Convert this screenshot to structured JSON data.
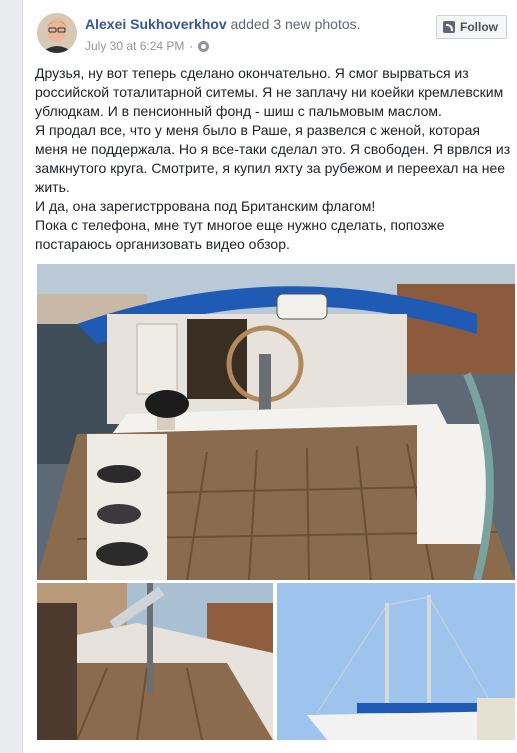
{
  "post": {
    "author": "Alexei Sukhoverkhov",
    "action": "added 3 new photos.",
    "timestamp": "July 30 at 6:24 PM",
    "dot": "·",
    "privacy_icon": "globe-icon",
    "follow_label": "Follow",
    "text_lines": [
      "Друзья, ну вот теперь сделано окончательно. Я смог вырваться из российской тоталитарной ситемы. Я не заплачу ни коейки кремлевским ублюдкам. И в пенсионный фонд - шиш с пальмовым маслом.",
      "Я продал все, что у меня было в Раше, я развелся с женой, которая меня не поддержала. Но я все-таки сделал это. Я свободен. Я врвлся из замкнутого круга. Смотрите, я купил яхту за рубежом и переехал на нее жить.",
      "И да, она зарегистррована под Британским флагом!",
      "Пока с телефона, мне тут многое еще нужно сделать, попозже постараюсь организовать видео обзор."
    ]
  },
  "colors": {
    "link": "#365899",
    "muted": "#90949c",
    "bimini": "#1f5bb5",
    "teak": "#8a6b4e",
    "sky": "#9ec3ec"
  }
}
